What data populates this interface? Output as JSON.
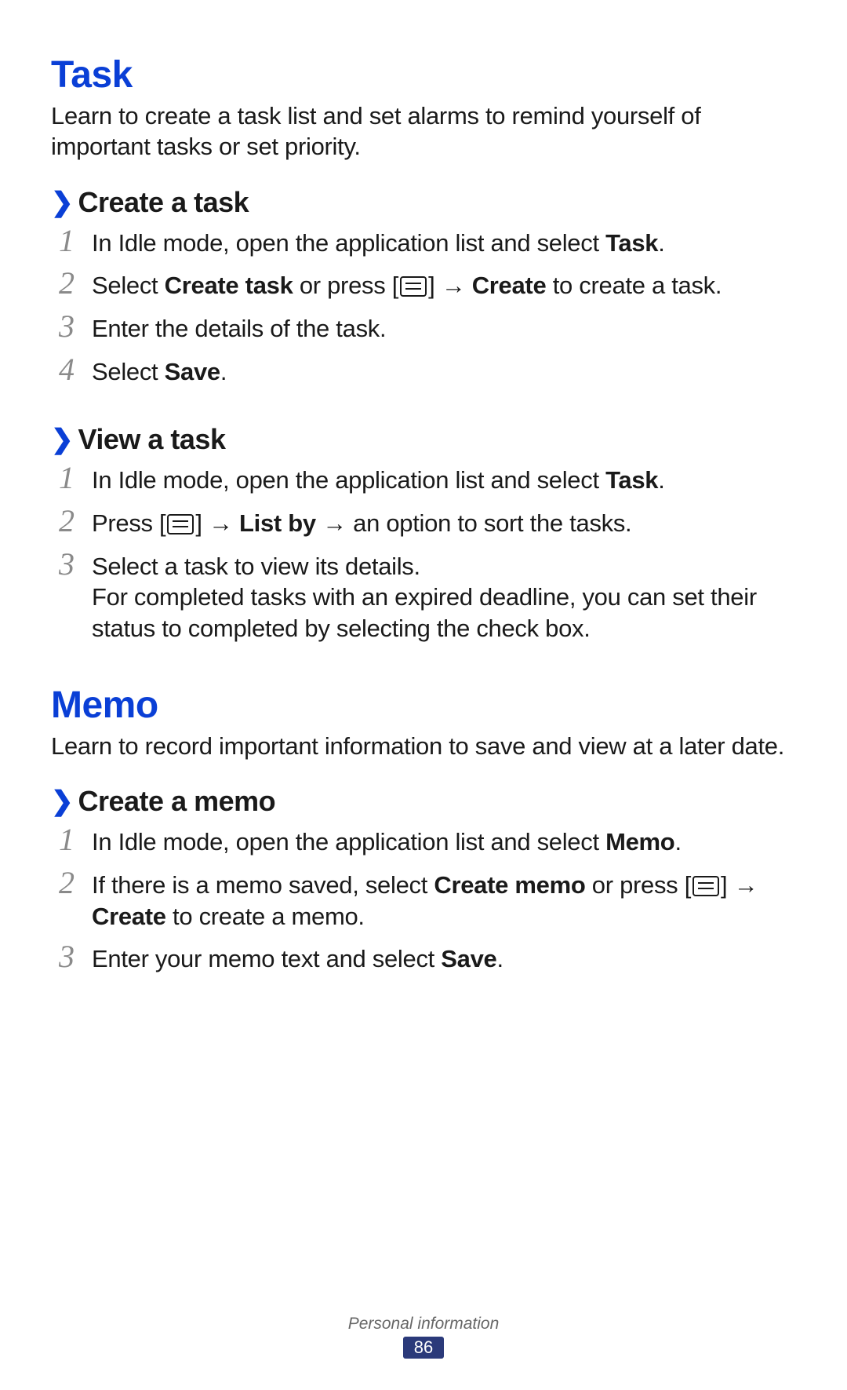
{
  "sections": [
    {
      "title": "Task",
      "intro": "Learn to create a task list and set alarms to remind yourself of important tasks or set priority.",
      "subs": [
        {
          "title": "Create a task",
          "steps": [
            {
              "num": "1",
              "html": "In Idle mode, open the application list and select <b>Task</b>."
            },
            {
              "num": "2",
              "html": "Select <b>Create task</b> or press [<span class=\"menu-icon\" data-name=\"menu-icon\" data-interactable=\"false\"><span></span></span>] → <b>Create</b> to create a task."
            },
            {
              "num": "3",
              "html": "Enter the details of the task."
            },
            {
              "num": "4",
              "html": "Select <b>Save</b>."
            }
          ]
        },
        {
          "title": "View a task",
          "steps": [
            {
              "num": "1",
              "html": "In Idle mode, open the application list and select <b>Task</b>."
            },
            {
              "num": "2",
              "html": "Press [<span class=\"menu-icon\" data-name=\"menu-icon\" data-interactable=\"false\"><span></span></span>] → <b>List by</b> → an option to sort the tasks."
            },
            {
              "num": "3",
              "html": "Select a task to view its details.<br>For completed tasks with an expired deadline, you can set their status to completed by selecting the check box."
            }
          ]
        }
      ]
    },
    {
      "title": "Memo",
      "intro": "Learn to record important information to save and view at a later date.",
      "subs": [
        {
          "title": "Create a memo",
          "steps": [
            {
              "num": "1",
              "html": "In Idle mode, open the application list and select <b>Memo</b>."
            },
            {
              "num": "2",
              "html": "If there is a memo saved, select <b>Create memo</b> or press [<span class=\"menu-icon\" data-name=\"menu-icon\" data-interactable=\"false\"><span></span></span>] → <b>Create</b> to create a memo."
            },
            {
              "num": "3",
              "html": "Enter your memo text and select <b>Save</b>."
            }
          ]
        }
      ]
    }
  ],
  "footer": {
    "section": "Personal information",
    "page": "86"
  }
}
